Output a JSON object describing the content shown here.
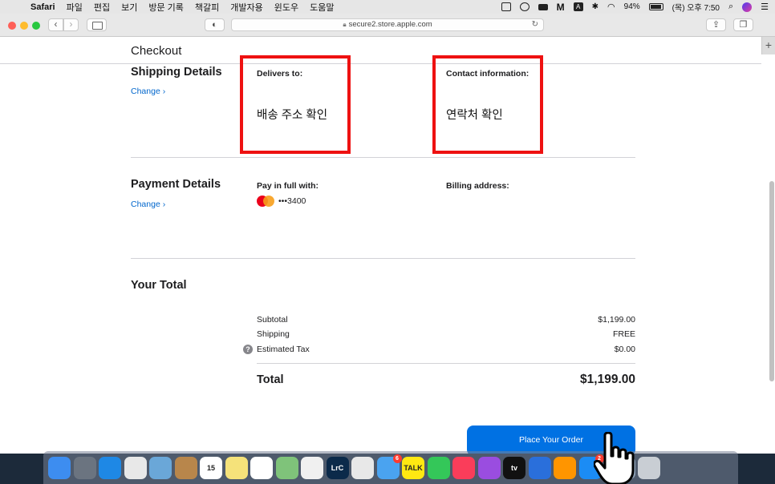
{
  "menubar": {
    "app_name": "Safari",
    "menus": [
      "파일",
      "편집",
      "보기",
      "방문 기록",
      "책갈피",
      "개발자용",
      "윈도우",
      "도움말"
    ],
    "battery": "94%",
    "clock": "(목) 오후 7:50",
    "status_icons": [
      "window-icon",
      "creative-cloud-icon",
      "drive-icon",
      "gmail-icon",
      "a-icon",
      "bluetooth-icon",
      "wifi-icon",
      "battery-icon",
      "search-icon",
      "siri-icon",
      "control-center-icon"
    ]
  },
  "browser": {
    "url": "secure2.store.apple.com"
  },
  "checkout": {
    "title": "Checkout",
    "shipping": {
      "title": "Shipping Details",
      "change": "Change ›",
      "delivers_label": "Delivers to:",
      "delivers_value": "배송 주소 확인",
      "contact_label": "Contact information:",
      "contact_value": "연락처 확인"
    },
    "payment": {
      "title": "Payment Details",
      "change": "Change ›",
      "pay_label": "Pay in full with:",
      "card": "•••3400",
      "billing_label": "Billing address:"
    },
    "total": {
      "title": "Your Total",
      "rows": [
        {
          "label": "Subtotal",
          "value": "$1,199.00"
        },
        {
          "label": "Shipping",
          "value": "FREE"
        },
        {
          "label": "Estimated Tax",
          "value": "$0.00"
        }
      ],
      "total_label": "Total",
      "total_value": "$1,199.00"
    },
    "place_order": "Place Your Order"
  },
  "dock": {
    "apps": [
      {
        "name": "finder-icon",
        "color": "#3d8df0",
        "label": ""
      },
      {
        "name": "launchpad-icon",
        "color": "#6b7480",
        "label": ""
      },
      {
        "name": "safari-icon",
        "color": "#1e88e5",
        "label": ""
      },
      {
        "name": "chrome-icon",
        "color": "#e8e8e8",
        "label": ""
      },
      {
        "name": "preview-icon",
        "color": "#6aa7d8",
        "label": ""
      },
      {
        "name": "contacts-icon",
        "color": "#b8864b",
        "label": ""
      },
      {
        "name": "calendar-icon",
        "color": "#ffffff",
        "label": "15"
      },
      {
        "name": "notes-icon",
        "color": "#f5e27a",
        "label": ""
      },
      {
        "name": "reminders-icon",
        "color": "#ffffff",
        "label": ""
      },
      {
        "name": "maps-icon",
        "color": "#7fc37a",
        "label": ""
      },
      {
        "name": "photos-icon",
        "color": "#f0f0f0",
        "label": ""
      },
      {
        "name": "lightroom-icon",
        "color": "#0b2a4a",
        "label": "LrC"
      },
      {
        "name": "creative-cloud-icon",
        "color": "#e8e8e8",
        "label": ""
      },
      {
        "name": "messages-icon",
        "color": "#4aa3f0",
        "label": "",
        "badge": "6"
      },
      {
        "name": "kakaotalk-icon",
        "color": "#ffe812",
        "label": "TALK"
      },
      {
        "name": "facetime-icon",
        "color": "#34c759",
        "label": ""
      },
      {
        "name": "music-icon",
        "color": "#fa3d5a",
        "label": ""
      },
      {
        "name": "podcasts-icon",
        "color": "#9a4de0",
        "label": ""
      },
      {
        "name": "apple-tv-icon",
        "color": "#111111",
        "label": "tv"
      },
      {
        "name": "quicktime-icon",
        "color": "#2a6fdb",
        "label": ""
      },
      {
        "name": "books-icon",
        "color": "#ff9500",
        "label": ""
      },
      {
        "name": "app-store-icon",
        "color": "#1b8cf5",
        "label": "",
        "badge": "2"
      }
    ],
    "right_apps": [
      {
        "name": "image-capture-icon",
        "color": "#8fa3b8",
        "label": ""
      },
      {
        "name": "trash-icon",
        "color": "#c9ced4",
        "label": ""
      }
    ]
  }
}
